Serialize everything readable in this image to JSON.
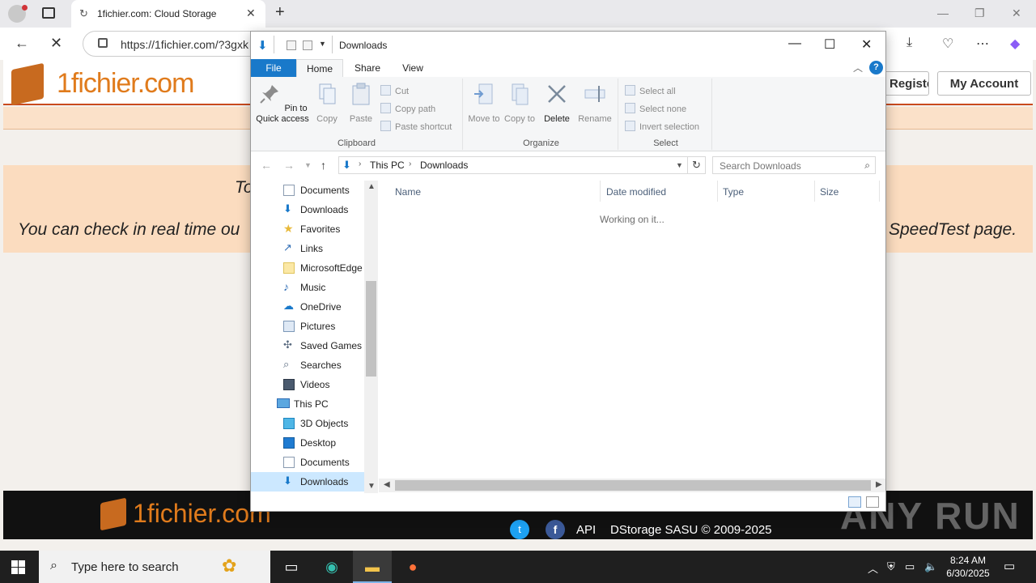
{
  "browser": {
    "tab_title": "1fichier.com: Cloud Storage",
    "url": "https://1fichier.com/?3gxk"
  },
  "site": {
    "logo": "1fichier.com",
    "register_label": "Register",
    "account_label": "My Account",
    "info_line1": "To",
    "info_line2_start": "You can check in real time ou",
    "info_line2_end": "SpeedTest page.",
    "footer_logo": "1fichier.com",
    "footer_api": "API",
    "footer_copyright": "DStorage SASU © 2009-2025",
    "watermark": "ANY RUN"
  },
  "explorer": {
    "title": "Downloads",
    "tabs": [
      "File",
      "Home",
      "Share",
      "View"
    ],
    "clipboard": {
      "pin": "Pin to Quick access",
      "copy": "Copy",
      "paste": "Paste",
      "cut": "Cut",
      "copy_path": "Copy path",
      "paste_shortcut": "Paste shortcut",
      "label": "Clipboard"
    },
    "organize": {
      "move_to": "Move to",
      "copy_to": "Copy to",
      "delete": "Delete",
      "rename": "Rename",
      "label": "Organize"
    },
    "select": {
      "select_all": "Select all",
      "select_none": "Select none",
      "invert": "Invert selection",
      "label": "Select"
    },
    "path": [
      "This PC",
      "Downloads"
    ],
    "search_placeholder": "Search Downloads",
    "nav_items": [
      {
        "label": "Documents",
        "icon": "document-icon"
      },
      {
        "label": "Downloads",
        "icon": "download-icon"
      },
      {
        "label": "Favorites",
        "icon": "star-icon"
      },
      {
        "label": "Links",
        "icon": "link-icon"
      },
      {
        "label": "MicrosoftEdge",
        "icon": "folder-icon"
      },
      {
        "label": "Music",
        "icon": "music-icon"
      },
      {
        "label": "OneDrive",
        "icon": "cloud-icon"
      },
      {
        "label": "Pictures",
        "icon": "picture-icon"
      },
      {
        "label": "Saved Games",
        "icon": "games-icon"
      },
      {
        "label": "Searches",
        "icon": "search-icon"
      },
      {
        "label": "Videos",
        "icon": "video-icon"
      },
      {
        "label": "This PC",
        "icon": "computer-icon"
      },
      {
        "label": "3D Objects",
        "icon": "cube-icon"
      },
      {
        "label": "Desktop",
        "icon": "desktop-icon"
      },
      {
        "label": "Documents",
        "icon": "document-icon"
      },
      {
        "label": "Downloads",
        "icon": "download-icon"
      }
    ],
    "columns": [
      "Name",
      "Date modified",
      "Type",
      "Size"
    ],
    "status_text": "Working on it..."
  },
  "taskbar": {
    "search_placeholder": "Type here to search",
    "time": "8:24 AM",
    "date": "6/30/2025"
  },
  "colors": {
    "accent_blue": "#1979ca",
    "brand_orange": "#e07b1c",
    "info_band": "#fbdcbf"
  }
}
